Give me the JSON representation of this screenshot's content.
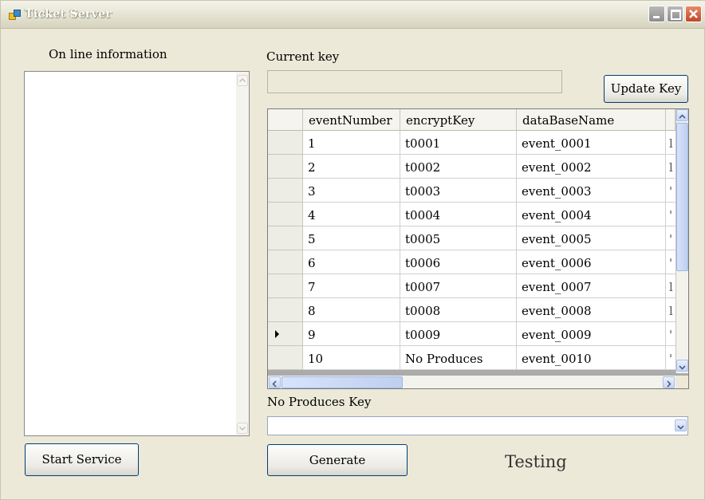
{
  "window": {
    "title": "Ticket Server"
  },
  "left": {
    "online_label": "On line information"
  },
  "key": {
    "current_label": "Current key",
    "value": "",
    "update_button": "Update Key"
  },
  "grid": {
    "columns": [
      "eventNumber",
      "encryptKey",
      "dataBaseName"
    ],
    "rows": [
      [
        "1",
        "t0001",
        "event_0001",
        "l"
      ],
      [
        "2",
        "t0002",
        "event_0002",
        "l"
      ],
      [
        "3",
        "t0003",
        "event_0003",
        "'"
      ],
      [
        "4",
        "t0004",
        "event_0004",
        "'"
      ],
      [
        "5",
        "t0005",
        "event_0005",
        "'"
      ],
      [
        "6",
        "t0006",
        "event_0006",
        "'"
      ],
      [
        "7",
        "t0007",
        "event_0007",
        "l"
      ],
      [
        "8",
        "t0008",
        "event_0008",
        "l"
      ],
      [
        "9",
        "t0009",
        "event_0009",
        "'"
      ],
      [
        "10",
        "No Produces",
        "event_0010",
        "'"
      ]
    ],
    "current_row": 9
  },
  "produces": {
    "label": "No Produces Key",
    "selected": ""
  },
  "buttons": {
    "start": "Start Service",
    "generate": "Generate"
  },
  "status": {
    "text": "Testing"
  },
  "colors": {
    "window_bg": "#ece9d8",
    "grid_bg": "#ababab",
    "scroll_blue": "#c7d6f5"
  }
}
